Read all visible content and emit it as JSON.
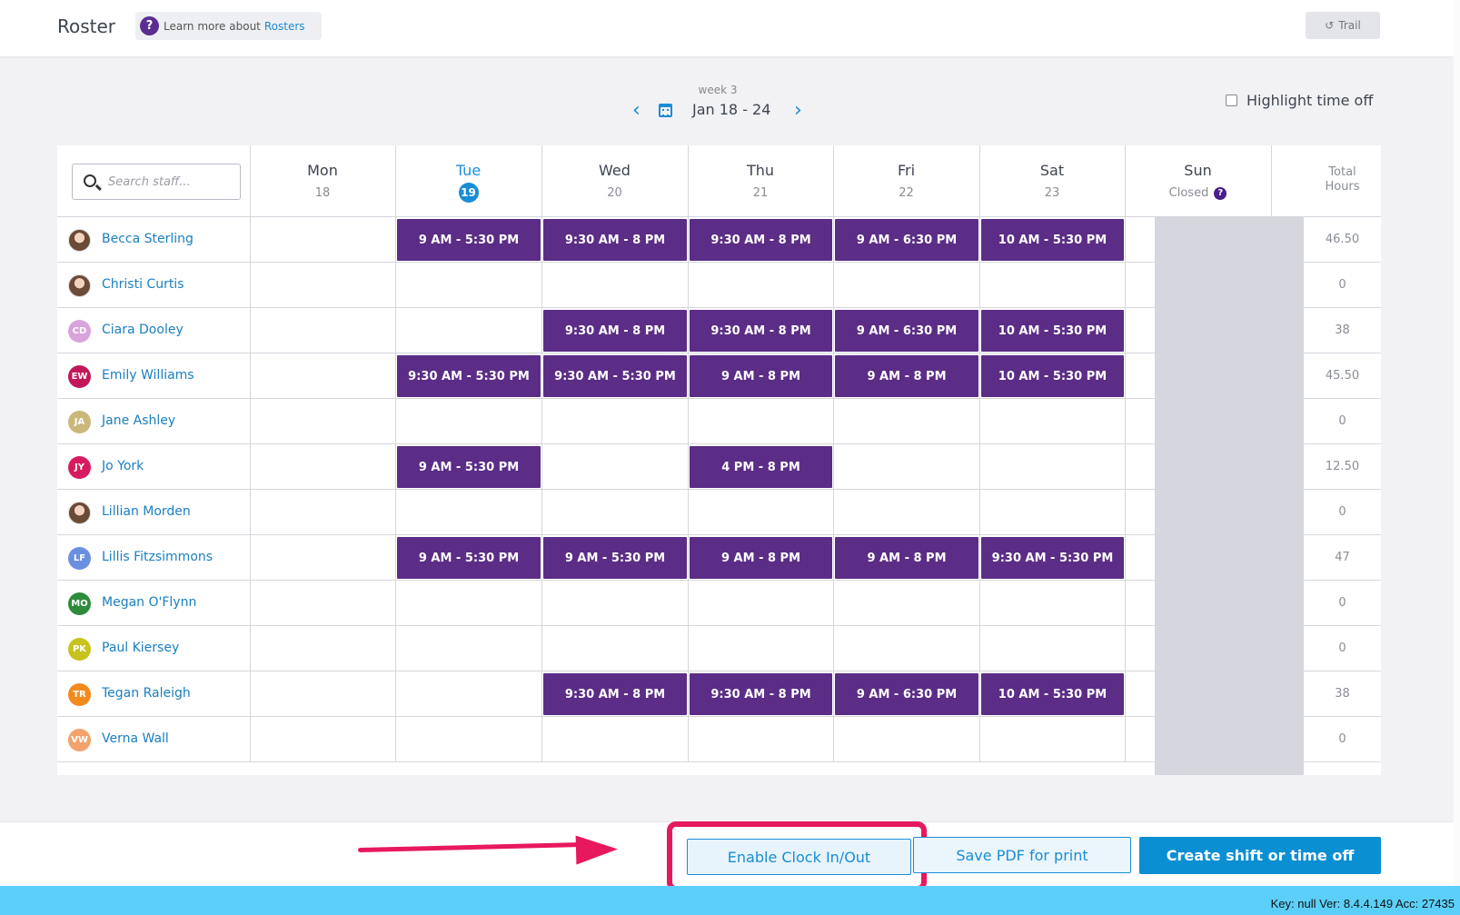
{
  "header": {
    "title": "Roster",
    "learn_prefix": "Learn more about",
    "learn_link": "Rosters",
    "trail_label": "Trail"
  },
  "week_nav": {
    "week_label": "week 3",
    "range": "Jan 18 - 24"
  },
  "highlight_time_off_label": "Highlight time off",
  "search": {
    "placeholder": "Search staff..."
  },
  "days": [
    {
      "name": "Mon",
      "num": "18"
    },
    {
      "name": "Tue",
      "num": "19",
      "today": true
    },
    {
      "name": "Wed",
      "num": "20"
    },
    {
      "name": "Thu",
      "num": "21"
    },
    {
      "name": "Fri",
      "num": "22"
    },
    {
      "name": "Sat",
      "num": "23"
    },
    {
      "name": "Sun",
      "num": "Closed"
    }
  ],
  "total_header": [
    "Total",
    "Hours"
  ],
  "staff": [
    {
      "name": "Becca Sterling",
      "initials": "",
      "avatar_color": "",
      "photo": true,
      "shifts": [
        "",
        "9 AM - 5:30 PM",
        "9:30 AM - 8 PM",
        "9:30 AM - 8 PM",
        "9 AM - 6:30 PM",
        "10 AM - 5:30 PM",
        ""
      ],
      "total": "46.50"
    },
    {
      "name": "Christi Curtis",
      "initials": "",
      "avatar_color": "",
      "photo": true,
      "shifts": [
        "",
        "",
        "",
        "",
        "",
        "",
        ""
      ],
      "total": "0"
    },
    {
      "name": "Ciara Dooley",
      "initials": "CD",
      "avatar_color": "#d9a3dc",
      "photo": false,
      "shifts": [
        "",
        "",
        "9:30 AM - 8 PM",
        "9:30 AM - 8 PM",
        "9 AM - 6:30 PM",
        "10 AM - 5:30 PM",
        ""
      ],
      "total": "38"
    },
    {
      "name": "Emily Williams",
      "initials": "EW",
      "avatar_color": "#c2185b",
      "photo": false,
      "shifts": [
        "",
        "9:30 AM - 5:30 PM",
        "9:30 AM - 5:30 PM",
        "9 AM - 8 PM",
        "9 AM - 8 PM",
        "10 AM - 5:30 PM",
        ""
      ],
      "total": "45.50"
    },
    {
      "name": "Jane Ashley",
      "initials": "JA",
      "avatar_color": "#c9b87a",
      "photo": false,
      "shifts": [
        "",
        "",
        "",
        "",
        "",
        "",
        ""
      ],
      "total": "0"
    },
    {
      "name": "Jo York",
      "initials": "JY",
      "avatar_color": "#d81b60",
      "photo": false,
      "shifts": [
        "",
        "9 AM - 5:30 PM",
        "",
        "4 PM - 8 PM",
        "",
        "",
        ""
      ],
      "total": "12.50"
    },
    {
      "name": "Lillian Morden",
      "initials": "",
      "avatar_color": "",
      "photo": true,
      "shifts": [
        "",
        "",
        "",
        "",
        "",
        "",
        ""
      ],
      "total": "0"
    },
    {
      "name": "Lillis Fitzsimmons",
      "initials": "LF",
      "avatar_color": "#6b8fe0",
      "photo": false,
      "shifts": [
        "",
        "9 AM - 5:30 PM",
        "9 AM - 5:30 PM",
        "9 AM - 8 PM",
        "9 AM - 8 PM",
        "9:30 AM - 5:30 PM",
        ""
      ],
      "total": "47"
    },
    {
      "name": "Megan O'Flynn",
      "initials": "MO",
      "avatar_color": "#2e8b3a",
      "photo": false,
      "shifts": [
        "",
        "",
        "",
        "",
        "",
        "",
        ""
      ],
      "total": "0"
    },
    {
      "name": "Paul Kiersey",
      "initials": "PK",
      "avatar_color": "#c8c21e",
      "photo": false,
      "shifts": [
        "",
        "",
        "",
        "",
        "",
        "",
        ""
      ],
      "total": "0"
    },
    {
      "name": "Tegan Raleigh",
      "initials": "TR",
      "avatar_color": "#f28a1e",
      "photo": false,
      "shifts": [
        "",
        "",
        "9:30 AM - 8 PM",
        "9:30 AM - 8 PM",
        "9 AM - 6:30 PM",
        "10 AM - 5:30 PM",
        ""
      ],
      "total": "38"
    },
    {
      "name": "Verna Wall",
      "initials": "VW",
      "avatar_color": "#f2a36b",
      "photo": false,
      "shifts": [
        "",
        "",
        "",
        "",
        "",
        "",
        ""
      ],
      "total": "0"
    }
  ],
  "actions": {
    "clock_label": "Enable Clock In/Out",
    "pdf_label": "Save PDF for print",
    "create_label": "Create shift or time off"
  },
  "footer": {
    "text": "Key: null Ver: 8.4.4.149 Acc: 27435"
  },
  "colors": {
    "shift_bg": "#5b2d86",
    "accent": "#1a8dd6",
    "callout": "#e8185f",
    "closed_shade": "#d5d6de"
  }
}
